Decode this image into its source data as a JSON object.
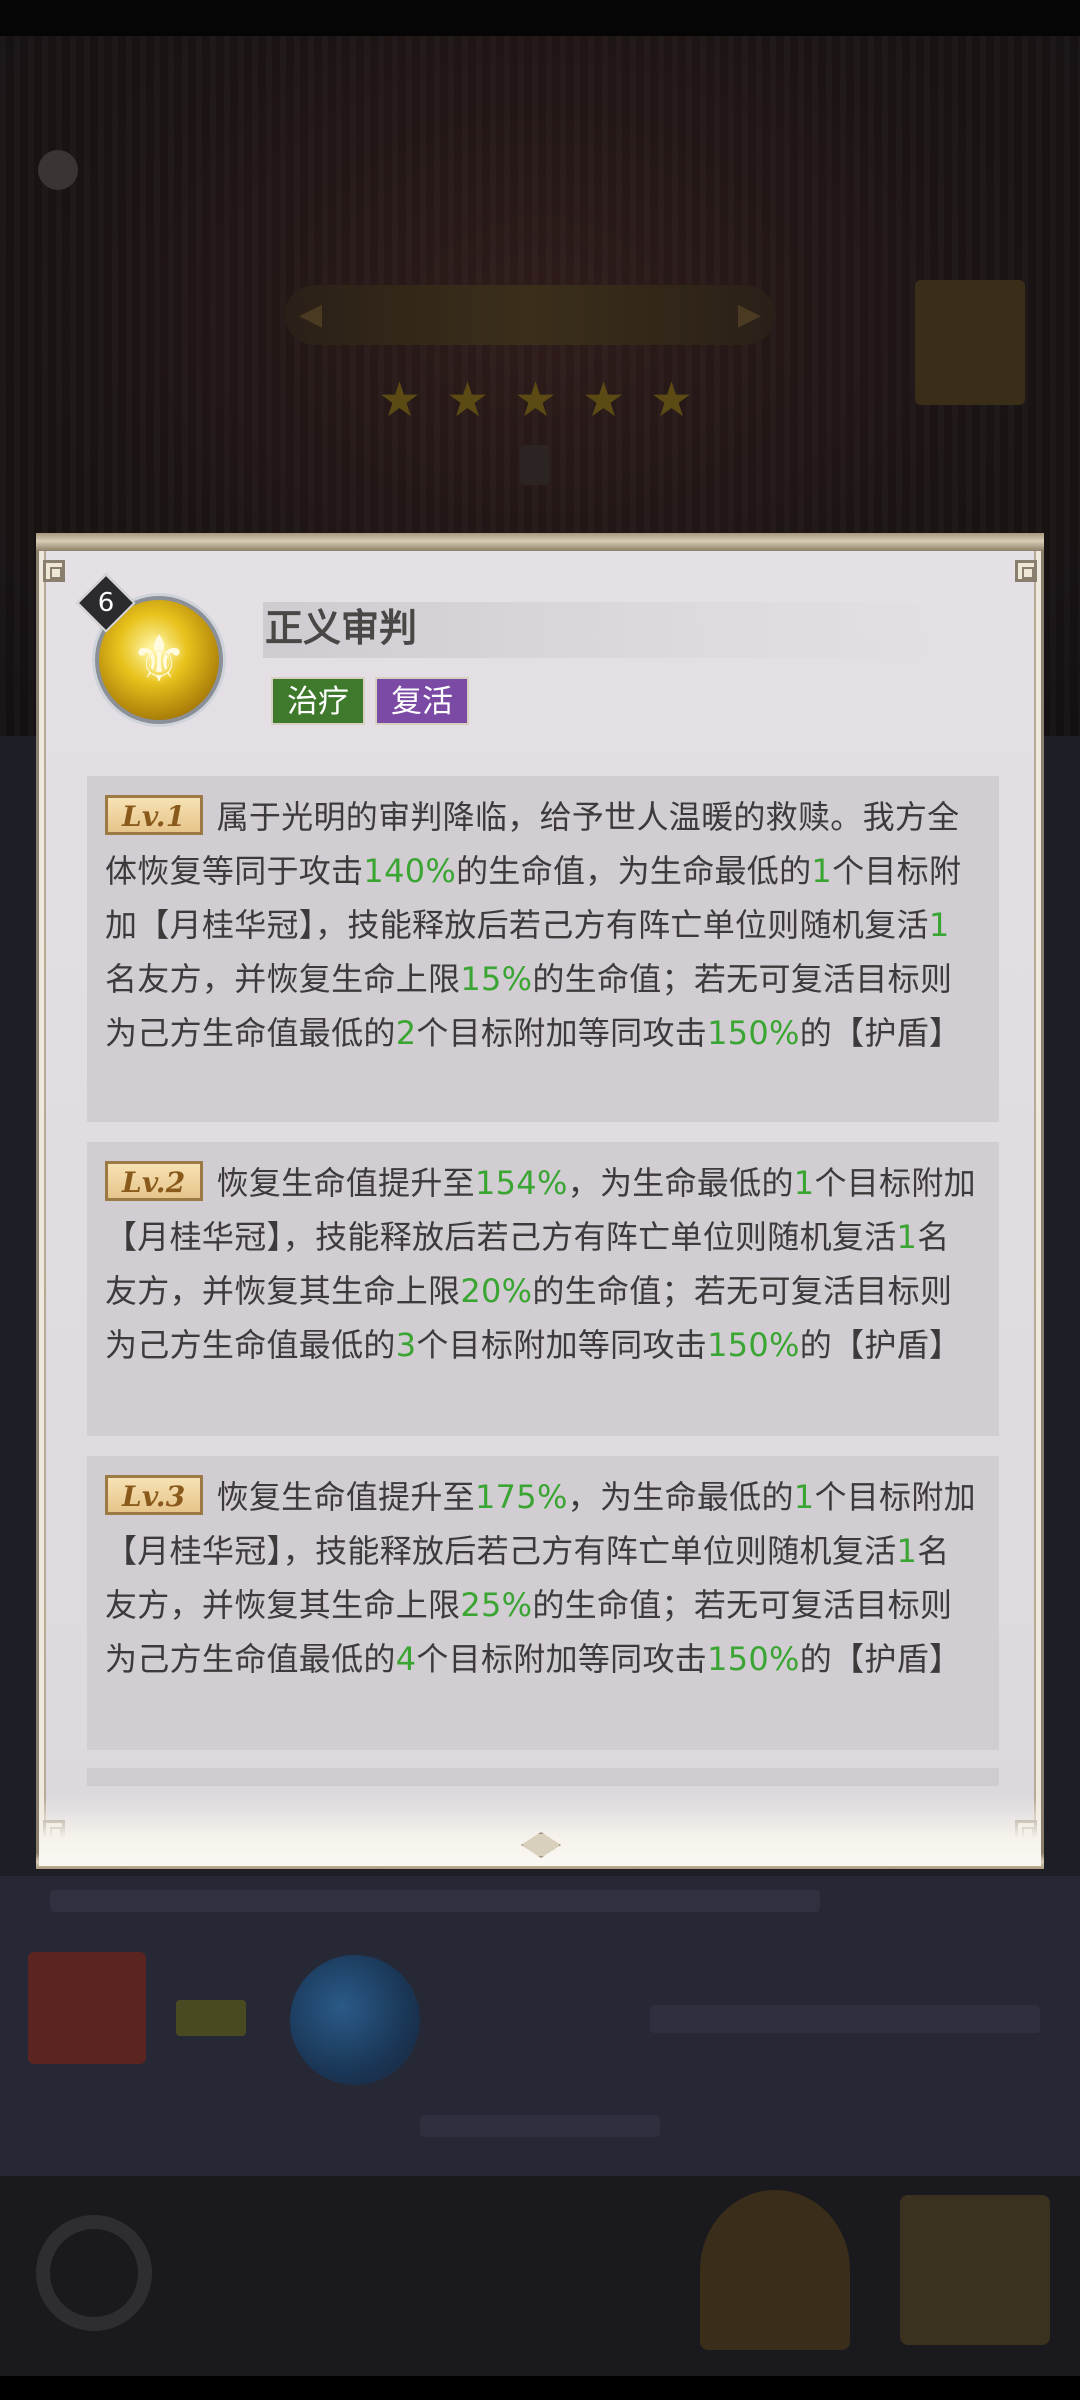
{
  "skill": {
    "name": "正义审判",
    "level": "6",
    "icon": "holy-emblem-icon",
    "tags": [
      {
        "label": "治疗",
        "color": "#3f7a2c"
      },
      {
        "label": "复活",
        "color": "#7b4aa5"
      }
    ]
  },
  "levels": [
    {
      "badge": "Lv.1",
      "segments": [
        {
          "text": "属于光明的审判降临，给予世人温暖的救赎。我方全体恢复等同于攻击",
          "highlight": false
        },
        {
          "text": "140%",
          "highlight": true
        },
        {
          "text": "的生命值，为生命最低的",
          "highlight": false
        },
        {
          "text": "1",
          "highlight": true
        },
        {
          "text": "个目标附加【月桂华冠】，技能释放后若己方有阵亡单位则随机复活",
          "highlight": false
        },
        {
          "text": "1",
          "highlight": true
        },
        {
          "text": "名友方，并恢复生命上限",
          "highlight": false
        },
        {
          "text": "15%",
          "highlight": true
        },
        {
          "text": "的生命值；若无可复活目标则为己方生命值最低的",
          "highlight": false
        },
        {
          "text": "2",
          "highlight": true
        },
        {
          "text": "个目标附加等同攻击",
          "highlight": false
        },
        {
          "text": "150%",
          "highlight": true
        },
        {
          "text": "的【护盾】",
          "highlight": false
        }
      ]
    },
    {
      "badge": "Lv.2",
      "segments": [
        {
          "text": "恢复生命值提升至",
          "highlight": false
        },
        {
          "text": "154%",
          "highlight": true
        },
        {
          "text": "，为生命最低的",
          "highlight": false
        },
        {
          "text": "1",
          "highlight": true
        },
        {
          "text": "个目标附加【月桂华冠】，技能释放后若己方有阵亡单位则随机复活",
          "highlight": false
        },
        {
          "text": "1",
          "highlight": true
        },
        {
          "text": "名友方，并恢复其生命上限",
          "highlight": false
        },
        {
          "text": "20%",
          "highlight": true
        },
        {
          "text": "的生命值；若无可复活目标则为己方生命值最低的",
          "highlight": false
        },
        {
          "text": "3",
          "highlight": true
        },
        {
          "text": "个目标附加等同攻击",
          "highlight": false
        },
        {
          "text": "150%",
          "highlight": true
        },
        {
          "text": "的【护盾】",
          "highlight": false
        }
      ]
    },
    {
      "badge": "Lv.3",
      "segments": [
        {
          "text": "恢复生命值提升至",
          "highlight": false
        },
        {
          "text": "175%",
          "highlight": true
        },
        {
          "text": "，为生命最低的",
          "highlight": false
        },
        {
          "text": "1",
          "highlight": true
        },
        {
          "text": "个目标附加【月桂华冠】，技能释放后若己方有阵亡单位则随机复活",
          "highlight": false
        },
        {
          "text": "1",
          "highlight": true
        },
        {
          "text": "名友方，并恢复其生命上限",
          "highlight": false
        },
        {
          "text": "25%",
          "highlight": true
        },
        {
          "text": "的生命值；若无可复活目标则为己方生命值最低的",
          "highlight": false
        },
        {
          "text": "4",
          "highlight": true
        },
        {
          "text": "个目标附加等同攻击",
          "highlight": false
        },
        {
          "text": "150%",
          "highlight": true
        },
        {
          "text": "的【护盾】",
          "highlight": false
        }
      ]
    }
  ],
  "colors": {
    "highlight": "#3aa532",
    "body_text": "#3e3a3b",
    "panel": "#e4e0e5"
  }
}
